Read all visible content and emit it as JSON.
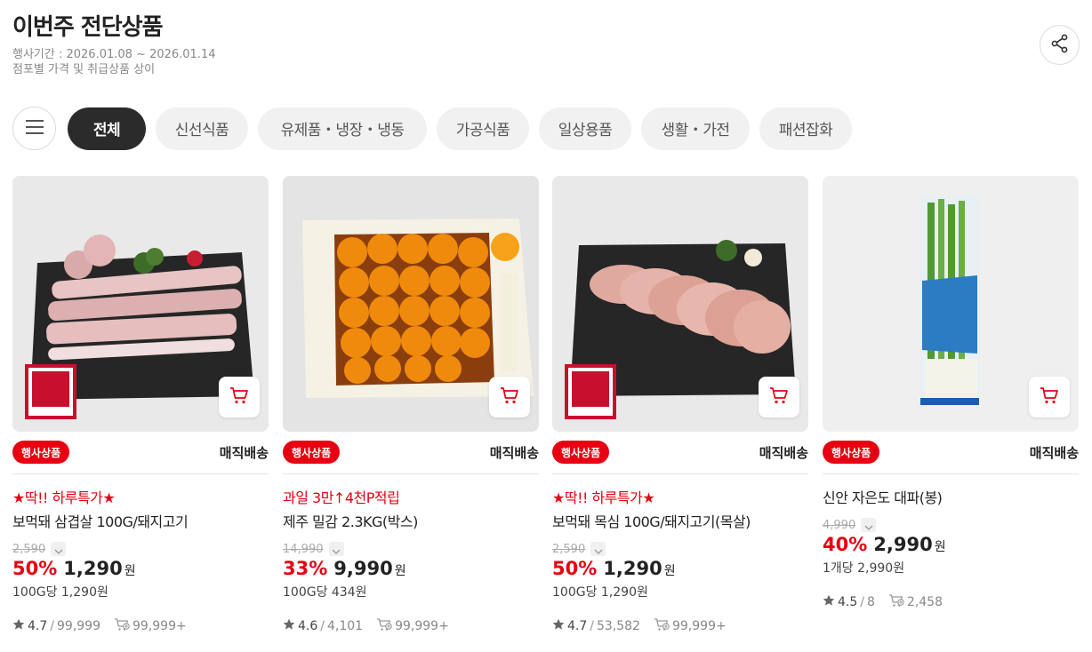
{
  "page": {
    "title": "이번주 전단상품",
    "period": "행사기간 : 2026.01.08 ~ 2026.01.14",
    "notice": "점포별 가격 및 취급상품 상이"
  },
  "tabs": [
    "전체",
    "신선식품",
    "유제품・냉장・냉동",
    "가공식품",
    "일상용품",
    "생활・가전",
    "패션잡화"
  ],
  "accent_color": "#e60012",
  "products": [
    {
      "badge": "행사상품",
      "delivery": "매직배송",
      "promo": "★딱!! 하루특가★",
      "name": "보먹돼 삼겹살 100G/돼지고기",
      "original_price": "2,590",
      "discount": "50%",
      "price": "1,290",
      "currency": "원",
      "unit_price": "100G당 1,290원",
      "rating": "4.7",
      "reviews": "99,999",
      "cart_count": "99,999+",
      "image_label": "보먹돼"
    },
    {
      "badge": "행사상품",
      "delivery": "매직배송",
      "promo": "과일 3만↑4천P적립",
      "name": "제주 밀감 2.3KG(박스)",
      "original_price": "14,990",
      "discount": "33%",
      "price": "9,990",
      "currency": "원",
      "unit_price": "100G당 434원",
      "rating": "4.6",
      "reviews": "4,101",
      "cart_count": "99,999+",
      "image_label": "제주 밀감"
    },
    {
      "badge": "행사상품",
      "delivery": "매직배송",
      "promo": "★딱!! 하루특가★",
      "name": "보먹돼 목심 100G/돼지고기(목살)",
      "original_price": "2,590",
      "discount": "50%",
      "price": "1,290",
      "currency": "원",
      "unit_price": "100G당 1,290원",
      "rating": "4.7",
      "reviews": "53,582",
      "cart_count": "99,999+",
      "image_label": "보먹돼"
    },
    {
      "badge": "행사상품",
      "delivery": "매직배송",
      "promo": "",
      "name": "신안 자은도 대파(봉)",
      "original_price": "4,990",
      "discount": "40%",
      "price": "2,990",
      "currency": "원",
      "unit_price": "1개당 2,990원",
      "rating": "4.5",
      "reviews": "8",
      "cart_count": "2,458",
      "image_label": "신안 자은도 대파"
    }
  ]
}
